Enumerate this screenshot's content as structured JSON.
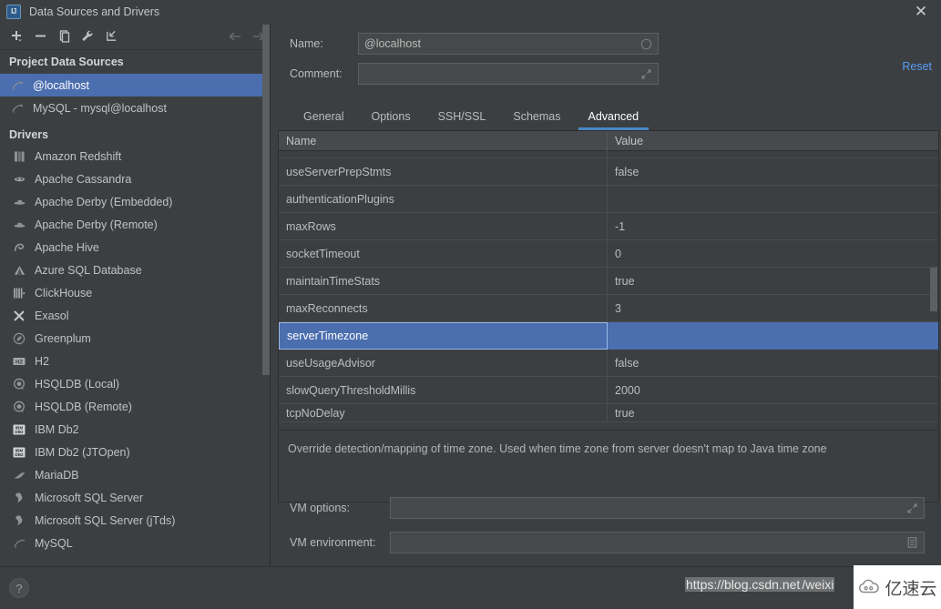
{
  "window": {
    "title": "Data Sources and Drivers",
    "app_icon": "intellij-idea-icon",
    "close_label": "✕"
  },
  "left_panel": {
    "toolbar": [
      {
        "name": "add-button",
        "glyph": "+"
      },
      {
        "name": "remove-button",
        "glyph": "−"
      },
      {
        "name": "copy-button",
        "glyph": "copy-icon"
      },
      {
        "name": "properties-button",
        "glyph": "wrench-icon"
      },
      {
        "name": "import-button",
        "glyph": "import-icon"
      },
      {
        "name": "back-button",
        "glyph": "←"
      },
      {
        "name": "forward-button",
        "glyph": "→"
      }
    ],
    "project_data_sources_header": "Project Data Sources",
    "data_sources": [
      {
        "label": "@localhost",
        "selected": true,
        "icon": "mysql-icon"
      },
      {
        "label": "MySQL - mysql@localhost",
        "selected": false,
        "icon": "mysql-icon"
      }
    ],
    "drivers_header": "Drivers",
    "drivers": [
      {
        "label": "Amazon Redshift",
        "icon": "redshift-icon"
      },
      {
        "label": "Apache Cassandra",
        "icon": "cassandra-icon"
      },
      {
        "label": "Apache Derby (Embedded)",
        "icon": "derby-icon"
      },
      {
        "label": "Apache Derby (Remote)",
        "icon": "derby-icon"
      },
      {
        "label": "Apache Hive",
        "icon": "hive-icon"
      },
      {
        "label": "Azure SQL Database",
        "icon": "azure-icon"
      },
      {
        "label": "ClickHouse",
        "icon": "clickhouse-icon"
      },
      {
        "label": "Exasol",
        "icon": "exasol-icon"
      },
      {
        "label": "Greenplum",
        "icon": "greenplum-icon"
      },
      {
        "label": "H2",
        "icon": "h2-icon"
      },
      {
        "label": "HSQLDB (Local)",
        "icon": "hsqldb-icon"
      },
      {
        "label": "HSQLDB (Remote)",
        "icon": "hsqldb-icon"
      },
      {
        "label": "IBM Db2",
        "icon": "db2-icon"
      },
      {
        "label": "IBM Db2 (JTOpen)",
        "icon": "db2-icon"
      },
      {
        "label": "MariaDB",
        "icon": "mariadb-icon"
      },
      {
        "label": "Microsoft SQL Server",
        "icon": "mssql-icon"
      },
      {
        "label": "Microsoft SQL Server (jTds)",
        "icon": "mssql-icon"
      },
      {
        "label": "MySQL",
        "icon": "mysql-icon"
      }
    ],
    "help_label": "?"
  },
  "form": {
    "name_label": "Name:",
    "name_value": "@localhost",
    "name_placeholder": "",
    "name_field_icon": "circle-icon",
    "comment_label": "Comment:",
    "comment_value": "",
    "comment_placeholder": "",
    "comment_field_icon": "expand-icon",
    "reset_label": "Reset"
  },
  "tabs": [
    {
      "label": "General",
      "active": false
    },
    {
      "label": "Options",
      "active": false
    },
    {
      "label": "SSH/SSL",
      "active": false
    },
    {
      "label": "Schemas",
      "active": false
    },
    {
      "label": "Advanced",
      "active": true
    }
  ],
  "table": {
    "columns": [
      "Name",
      "Value"
    ],
    "rows": [
      {
        "name": "useServerPrepStmts",
        "value": "false",
        "selected": false
      },
      {
        "name": "authenticationPlugins",
        "value": "",
        "selected": false
      },
      {
        "name": "maxRows",
        "value": "-1",
        "selected": false
      },
      {
        "name": "socketTimeout",
        "value": "0",
        "selected": false
      },
      {
        "name": "maintainTimeStats",
        "value": "true",
        "selected": false
      },
      {
        "name": "maxReconnects",
        "value": "3",
        "selected": false
      },
      {
        "name": "serverTimezone",
        "value": "",
        "selected": true
      },
      {
        "name": "useUsageAdvisor",
        "value": "false",
        "selected": false
      },
      {
        "name": "slowQueryThresholdMillis",
        "value": "2000",
        "selected": false
      },
      {
        "name": "tcpNoDelay",
        "value": "true",
        "selected": false
      }
    ]
  },
  "description": "Override detection/mapping of time zone. Used when time zone from server doesn't map to Java time zone",
  "vm": {
    "options_label": "VM options:",
    "options_value": "",
    "options_icon": "expand-icon",
    "environment_label": "VM environment:",
    "environment_value": "",
    "environment_icon": "list-icon"
  },
  "watermark": {
    "url_part1": "https://blog.csdn.net",
    "url_part2": "/weixi",
    "brand": "亿速云",
    "brand_icon": "cloud-icon"
  },
  "colors": {
    "background": "#3c3f41",
    "selection_blue": "#4b6eaf",
    "link_blue": "#589df6",
    "tab_underline": "#4a88c7",
    "text": "#bbbbbb"
  }
}
